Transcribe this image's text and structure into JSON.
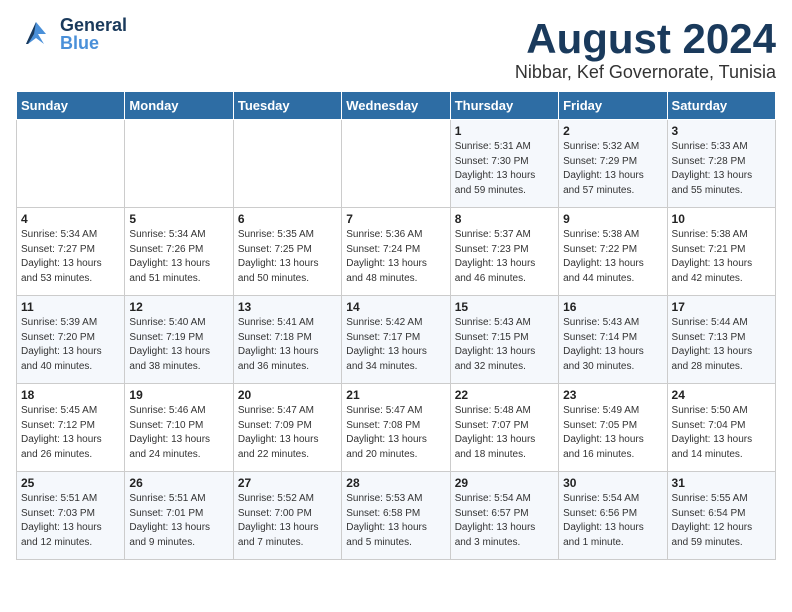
{
  "header": {
    "logo_general": "General",
    "logo_blue": "Blue",
    "month": "August 2024",
    "location": "Nibbar, Kef Governorate, Tunisia"
  },
  "days_of_week": [
    "Sunday",
    "Monday",
    "Tuesday",
    "Wednesday",
    "Thursday",
    "Friday",
    "Saturday"
  ],
  "weeks": [
    [
      {
        "day": "",
        "content": ""
      },
      {
        "day": "",
        "content": ""
      },
      {
        "day": "",
        "content": ""
      },
      {
        "day": "",
        "content": ""
      },
      {
        "day": "1",
        "content": "Sunrise: 5:31 AM\nSunset: 7:30 PM\nDaylight: 13 hours\nand 59 minutes."
      },
      {
        "day": "2",
        "content": "Sunrise: 5:32 AM\nSunset: 7:29 PM\nDaylight: 13 hours\nand 57 minutes."
      },
      {
        "day": "3",
        "content": "Sunrise: 5:33 AM\nSunset: 7:28 PM\nDaylight: 13 hours\nand 55 minutes."
      }
    ],
    [
      {
        "day": "4",
        "content": "Sunrise: 5:34 AM\nSunset: 7:27 PM\nDaylight: 13 hours\nand 53 minutes."
      },
      {
        "day": "5",
        "content": "Sunrise: 5:34 AM\nSunset: 7:26 PM\nDaylight: 13 hours\nand 51 minutes."
      },
      {
        "day": "6",
        "content": "Sunrise: 5:35 AM\nSunset: 7:25 PM\nDaylight: 13 hours\nand 50 minutes."
      },
      {
        "day": "7",
        "content": "Sunrise: 5:36 AM\nSunset: 7:24 PM\nDaylight: 13 hours\nand 48 minutes."
      },
      {
        "day": "8",
        "content": "Sunrise: 5:37 AM\nSunset: 7:23 PM\nDaylight: 13 hours\nand 46 minutes."
      },
      {
        "day": "9",
        "content": "Sunrise: 5:38 AM\nSunset: 7:22 PM\nDaylight: 13 hours\nand 44 minutes."
      },
      {
        "day": "10",
        "content": "Sunrise: 5:38 AM\nSunset: 7:21 PM\nDaylight: 13 hours\nand 42 minutes."
      }
    ],
    [
      {
        "day": "11",
        "content": "Sunrise: 5:39 AM\nSunset: 7:20 PM\nDaylight: 13 hours\nand 40 minutes."
      },
      {
        "day": "12",
        "content": "Sunrise: 5:40 AM\nSunset: 7:19 PM\nDaylight: 13 hours\nand 38 minutes."
      },
      {
        "day": "13",
        "content": "Sunrise: 5:41 AM\nSunset: 7:18 PM\nDaylight: 13 hours\nand 36 minutes."
      },
      {
        "day": "14",
        "content": "Sunrise: 5:42 AM\nSunset: 7:17 PM\nDaylight: 13 hours\nand 34 minutes."
      },
      {
        "day": "15",
        "content": "Sunrise: 5:43 AM\nSunset: 7:15 PM\nDaylight: 13 hours\nand 32 minutes."
      },
      {
        "day": "16",
        "content": "Sunrise: 5:43 AM\nSunset: 7:14 PM\nDaylight: 13 hours\nand 30 minutes."
      },
      {
        "day": "17",
        "content": "Sunrise: 5:44 AM\nSunset: 7:13 PM\nDaylight: 13 hours\nand 28 minutes."
      }
    ],
    [
      {
        "day": "18",
        "content": "Sunrise: 5:45 AM\nSunset: 7:12 PM\nDaylight: 13 hours\nand 26 minutes."
      },
      {
        "day": "19",
        "content": "Sunrise: 5:46 AM\nSunset: 7:10 PM\nDaylight: 13 hours\nand 24 minutes."
      },
      {
        "day": "20",
        "content": "Sunrise: 5:47 AM\nSunset: 7:09 PM\nDaylight: 13 hours\nand 22 minutes."
      },
      {
        "day": "21",
        "content": "Sunrise: 5:47 AM\nSunset: 7:08 PM\nDaylight: 13 hours\nand 20 minutes."
      },
      {
        "day": "22",
        "content": "Sunrise: 5:48 AM\nSunset: 7:07 PM\nDaylight: 13 hours\nand 18 minutes."
      },
      {
        "day": "23",
        "content": "Sunrise: 5:49 AM\nSunset: 7:05 PM\nDaylight: 13 hours\nand 16 minutes."
      },
      {
        "day": "24",
        "content": "Sunrise: 5:50 AM\nSunset: 7:04 PM\nDaylight: 13 hours\nand 14 minutes."
      }
    ],
    [
      {
        "day": "25",
        "content": "Sunrise: 5:51 AM\nSunset: 7:03 PM\nDaylight: 13 hours\nand 12 minutes."
      },
      {
        "day": "26",
        "content": "Sunrise: 5:51 AM\nSunset: 7:01 PM\nDaylight: 13 hours\nand 9 minutes."
      },
      {
        "day": "27",
        "content": "Sunrise: 5:52 AM\nSunset: 7:00 PM\nDaylight: 13 hours\nand 7 minutes."
      },
      {
        "day": "28",
        "content": "Sunrise: 5:53 AM\nSunset: 6:58 PM\nDaylight: 13 hours\nand 5 minutes."
      },
      {
        "day": "29",
        "content": "Sunrise: 5:54 AM\nSunset: 6:57 PM\nDaylight: 13 hours\nand 3 minutes."
      },
      {
        "day": "30",
        "content": "Sunrise: 5:54 AM\nSunset: 6:56 PM\nDaylight: 13 hours\nand 1 minute."
      },
      {
        "day": "31",
        "content": "Sunrise: 5:55 AM\nSunset: 6:54 PM\nDaylight: 12 hours\nand 59 minutes."
      }
    ]
  ]
}
